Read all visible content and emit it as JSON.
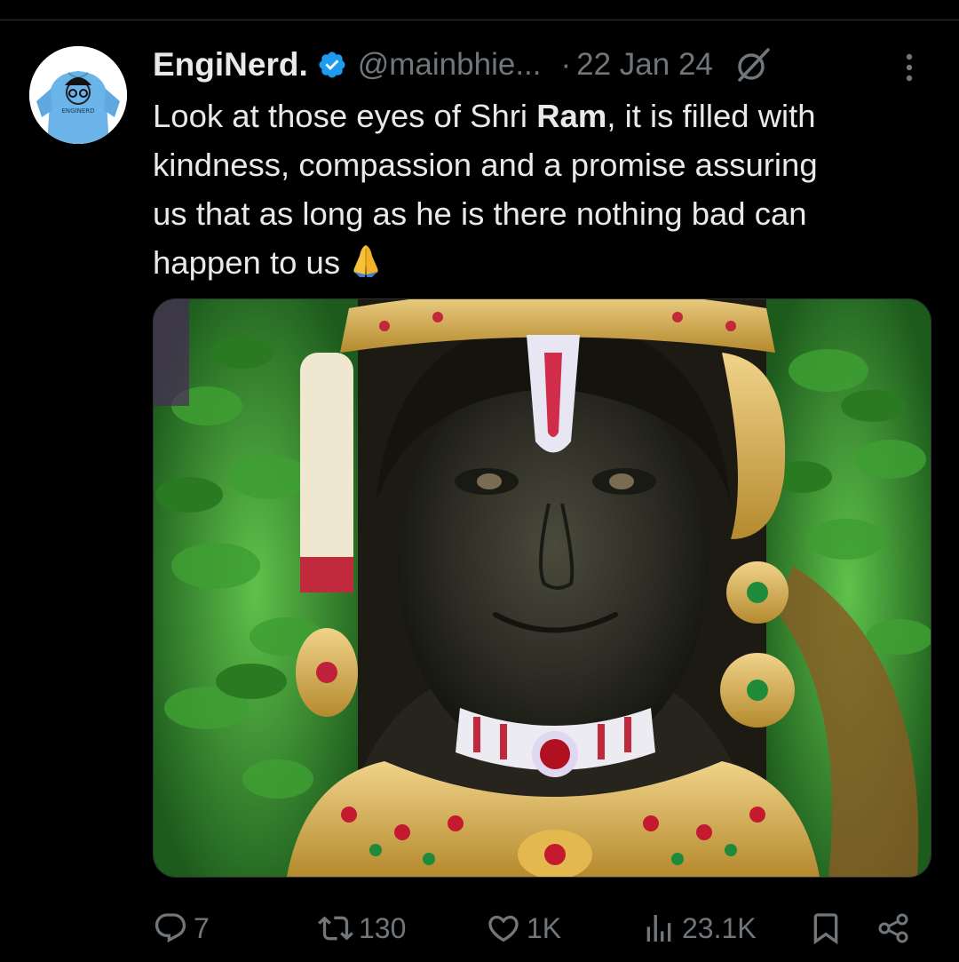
{
  "tweet": {
    "display_name": "EngiNerd.",
    "handle": "@mainbhie...",
    "separator": "·",
    "date": "22 Jan 24",
    "avatar_text": "ENGINERD",
    "text_lines": [
      {
        "before": "Look at those eyes of Shri ",
        "bold": "Ram",
        "after": ", it is filled with"
      },
      {
        "text": "kindness, compassion and a promise assuring"
      },
      {
        "text": "us that as long as he is there nothing bad can"
      },
      {
        "text": "happen to us"
      }
    ],
    "media_description": "Close-up of a dark stone deity idol adorned with jeweled crown, earrings and necklaces, surrounded by green leaves"
  },
  "actions": {
    "replies": "7",
    "reposts": "130",
    "likes": "1K",
    "views": "23.1K"
  },
  "icons": {
    "verified": "verified-badge-icon",
    "grok": "grok-icon",
    "more": "more-vertical-icon",
    "reply": "reply-icon",
    "repost": "repost-icon",
    "like": "heart-icon",
    "views": "views-icon",
    "bookmark": "bookmark-icon",
    "share": "share-icon",
    "emoji": "folded-hands-icon"
  },
  "colors": {
    "background": "#000000",
    "text": "#e7e9ea",
    "muted": "#71767b",
    "verified": "#1d9bf0"
  }
}
